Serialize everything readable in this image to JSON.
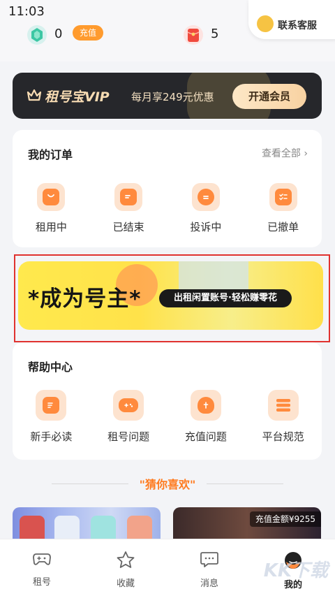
{
  "status_bar": {
    "time": "11:03"
  },
  "wallet": {
    "gem_count": "0",
    "recharge_label": "充值",
    "red_packet_count": "5",
    "customer_service_label": "联系客服"
  },
  "vip": {
    "brand": "租号宝VIP",
    "promo": "每月享249元优惠",
    "open_label": "开通会员"
  },
  "orders": {
    "title": "我的订单",
    "view_all": "查看全部 ›",
    "items": [
      {
        "label": "租用中",
        "icon": "bag-icon"
      },
      {
        "label": "已结束",
        "icon": "document-icon"
      },
      {
        "label": "投诉中",
        "icon": "chat-icon"
      },
      {
        "label": "已撤单",
        "icon": "checklist-icon"
      }
    ]
  },
  "promo_banner": {
    "headline": "*成为号主*",
    "slogan": "出租闲置账号·轻松赚零花"
  },
  "help": {
    "title": "帮助中心",
    "items": [
      {
        "label": "新手必读",
        "icon": "guide-icon"
      },
      {
        "label": "租号问题",
        "icon": "gamepad-icon"
      },
      {
        "label": "充值问题",
        "icon": "money-bag-icon"
      },
      {
        "label": "平台规范",
        "icon": "rules-icon"
      }
    ]
  },
  "recommend": {
    "title": "\"猜你喜欢\"",
    "card2_tag": "充值金额¥9255"
  },
  "nav": {
    "tabs": [
      {
        "label": "租号",
        "icon": "gamepad-icon"
      },
      {
        "label": "收藏",
        "icon": "star-icon"
      },
      {
        "label": "消息",
        "icon": "message-icon"
      },
      {
        "label": "我的",
        "icon": "profile-icon"
      }
    ]
  },
  "watermark": "KK下载"
}
